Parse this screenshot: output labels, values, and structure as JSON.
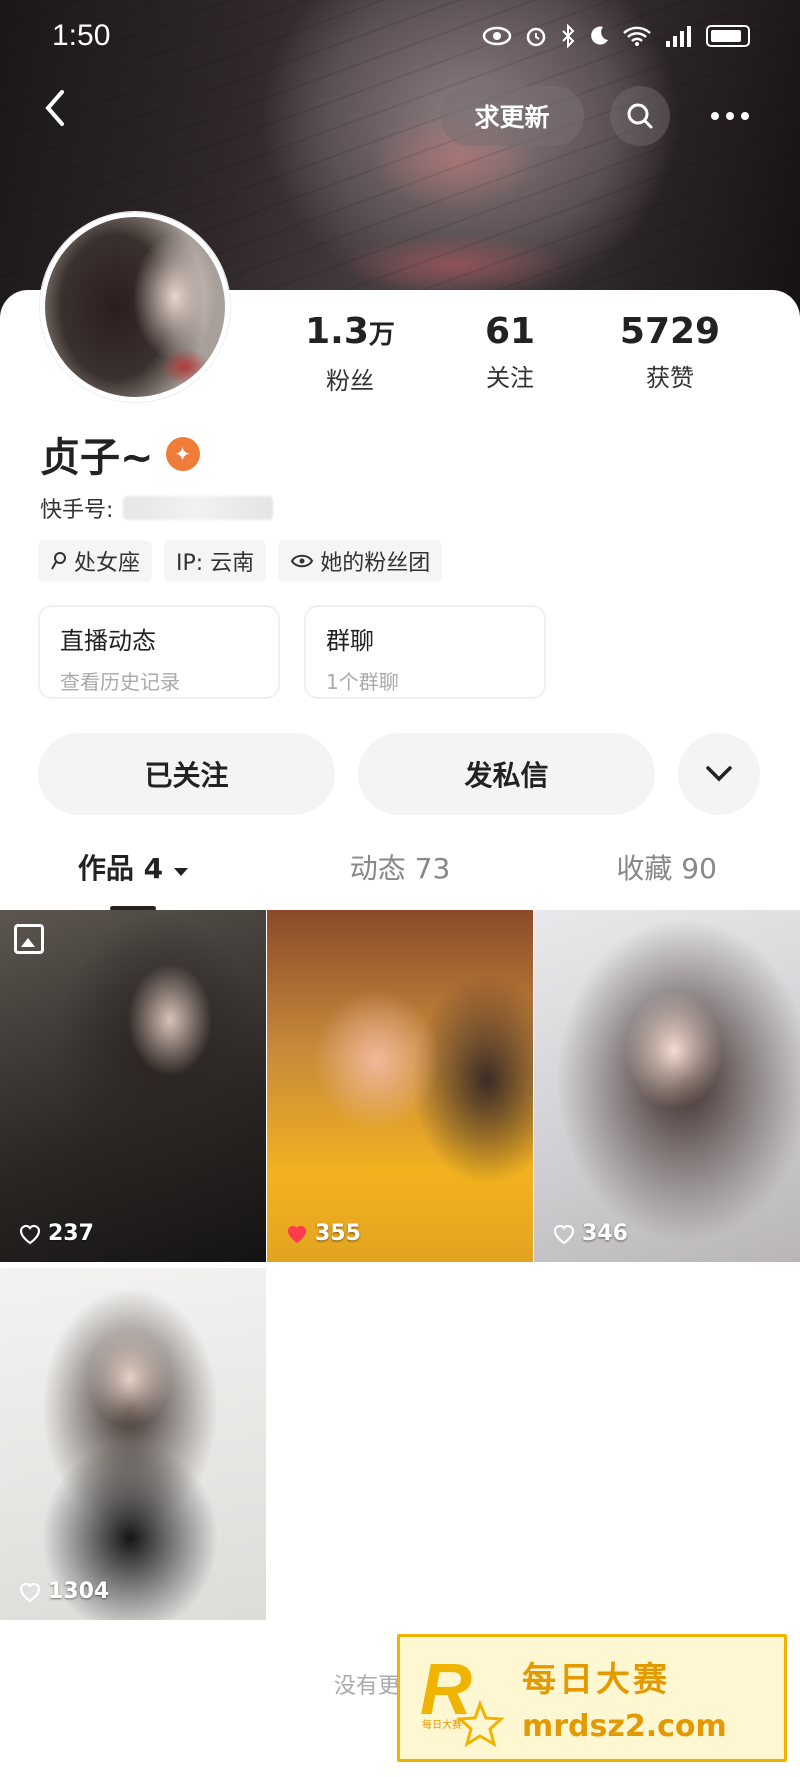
{
  "status_bar": {
    "time": "1:50"
  },
  "top_bar": {
    "request_update_label": "求更新"
  },
  "profile": {
    "name": "贞子~",
    "id_label": "快手号:",
    "stats": [
      {
        "value": "1.3",
        "unit": "万",
        "label": "粉丝"
      },
      {
        "value": "61",
        "unit": "",
        "label": "关注"
      },
      {
        "value": "5729",
        "unit": "",
        "label": "获赞"
      }
    ],
    "tags": [
      "处女座",
      "IP:  云南",
      "她的粉丝团"
    ],
    "feature_cards": [
      {
        "title": "直播动态",
        "subtitle": "查看历史记录"
      },
      {
        "title": "群聊",
        "subtitle": "1个群聊"
      }
    ]
  },
  "actions": {
    "follow_label": "已关注",
    "message_label": "发私信"
  },
  "tabs": [
    {
      "label": "作品 4",
      "active": true
    },
    {
      "label": "动态 73",
      "active": false
    },
    {
      "label": "收藏 90",
      "active": false
    }
  ],
  "works": [
    {
      "likes": "237",
      "liked": false,
      "type_icon": "image-icon"
    },
    {
      "likes": "355",
      "liked": true
    },
    {
      "likes": "346",
      "liked": false
    },
    {
      "likes": "1304",
      "liked": false
    }
  ],
  "footer": {
    "no_more_text": "没有更多作品"
  },
  "watermark": {
    "title": "每日大赛",
    "url": "mrdsz2.com",
    "logo_letter": "R",
    "logo_caption": "每日大赛"
  },
  "colors": {
    "accent_orange": "#f07c3a",
    "liked_red": "#ff3b4e",
    "watermark_gold": "#f0b400"
  }
}
